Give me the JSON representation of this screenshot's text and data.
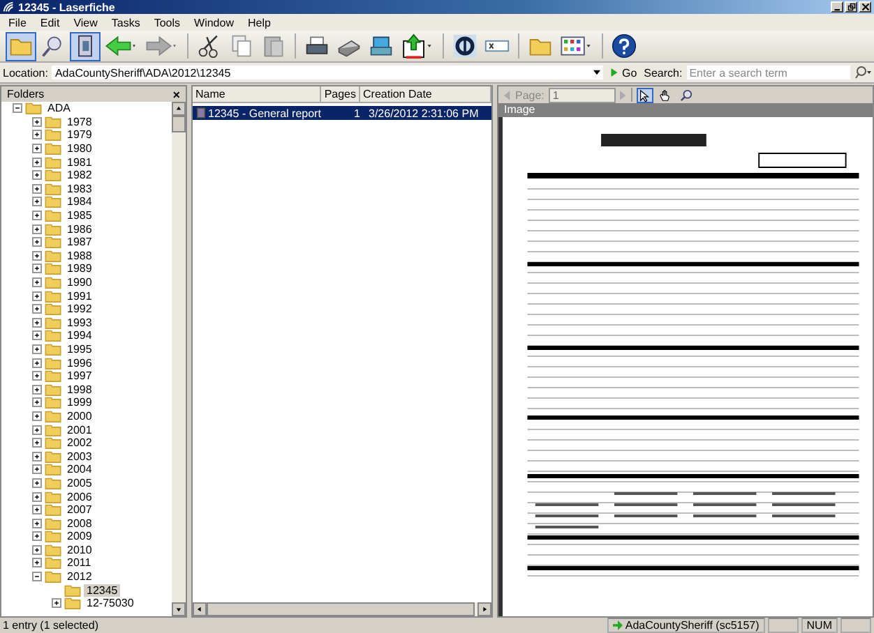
{
  "window": {
    "title": "12345 - Laserfiche"
  },
  "menu": [
    "File",
    "Edit",
    "View",
    "Tasks",
    "Tools",
    "Window",
    "Help"
  ],
  "location": {
    "label": "Location:",
    "value": "AdaCountySheriff\\ADA\\2012\\12345",
    "go": "Go",
    "search_label": "Search:",
    "search_placeholder": "Enter a search term"
  },
  "folders": {
    "title": "Folders",
    "close": "×",
    "tree": [
      {
        "label": "ADA",
        "expanded": true,
        "selected": false,
        "children": [
          {
            "label": "1978",
            "expanded": false,
            "selected": false
          },
          {
            "label": "1979",
            "expanded": false,
            "selected": false
          },
          {
            "label": "1980",
            "expanded": false,
            "selected": false
          },
          {
            "label": "1981",
            "expanded": false,
            "selected": false
          },
          {
            "label": "1982",
            "expanded": false,
            "selected": false
          },
          {
            "label": "1983",
            "expanded": false,
            "selected": false
          },
          {
            "label": "1984",
            "expanded": false,
            "selected": false
          },
          {
            "label": "1985",
            "expanded": false,
            "selected": false
          },
          {
            "label": "1986",
            "expanded": false,
            "selected": false
          },
          {
            "label": "1987",
            "expanded": false,
            "selected": false
          },
          {
            "label": "1988",
            "expanded": false,
            "selected": false
          },
          {
            "label": "1989",
            "expanded": false,
            "selected": false
          },
          {
            "label": "1990",
            "expanded": false,
            "selected": false
          },
          {
            "label": "1991",
            "expanded": false,
            "selected": false
          },
          {
            "label": "1992",
            "expanded": false,
            "selected": false
          },
          {
            "label": "1993",
            "expanded": false,
            "selected": false
          },
          {
            "label": "1994",
            "expanded": false,
            "selected": false
          },
          {
            "label": "1995",
            "expanded": false,
            "selected": false
          },
          {
            "label": "1996",
            "expanded": false,
            "selected": false
          },
          {
            "label": "1997",
            "expanded": false,
            "selected": false
          },
          {
            "label": "1998",
            "expanded": false,
            "selected": false
          },
          {
            "label": "1999",
            "expanded": false,
            "selected": false
          },
          {
            "label": "2000",
            "expanded": false,
            "selected": false
          },
          {
            "label": "2001",
            "expanded": false,
            "selected": false
          },
          {
            "label": "2002",
            "expanded": false,
            "selected": false
          },
          {
            "label": "2003",
            "expanded": false,
            "selected": false
          },
          {
            "label": "2004",
            "expanded": false,
            "selected": false
          },
          {
            "label": "2005",
            "expanded": false,
            "selected": false
          },
          {
            "label": "2006",
            "expanded": false,
            "selected": false
          },
          {
            "label": "2007",
            "expanded": false,
            "selected": false
          },
          {
            "label": "2008",
            "expanded": false,
            "selected": false
          },
          {
            "label": "2009",
            "expanded": false,
            "selected": false
          },
          {
            "label": "2010",
            "expanded": false,
            "selected": false
          },
          {
            "label": "2011",
            "expanded": false,
            "selected": false
          },
          {
            "label": "2012",
            "expanded": true,
            "selected": false,
            "children": [
              {
                "label": "12345",
                "selected": true
              },
              {
                "label": "12-75030",
                "expanded": false,
                "selected": false
              }
            ]
          }
        ]
      }
    ]
  },
  "list": {
    "columns": [
      "Name",
      "Pages",
      "Creation Date"
    ],
    "rows": [
      {
        "name": "12345 - General report",
        "pages": "1",
        "date": "3/26/2012 2:31:06 PM",
        "selected": true
      }
    ]
  },
  "viewer": {
    "page_label": "Page:",
    "page_value": "1",
    "title": "Image"
  },
  "status": {
    "text": "1 entry (1 selected)",
    "user": "AdaCountySheriff (sc5157)",
    "num": "NUM"
  }
}
